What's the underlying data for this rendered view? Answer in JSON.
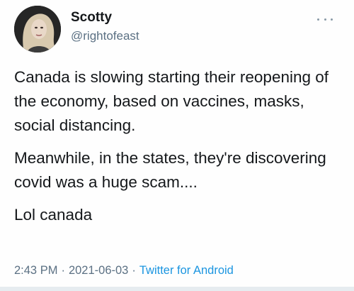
{
  "tweet": {
    "author": {
      "name": "Scotty",
      "handle": "@rightofeast"
    },
    "paragraphs": [
      "Canada is slowing starting their reopening of the economy, based on vaccines, masks, social distancing.",
      "Meanwhile, in the states, they're discovering covid was a huge scam....",
      "Lol canada"
    ],
    "time": "2:43 PM",
    "date": "2021-06-03",
    "separator": "·",
    "source": "Twitter for Android"
  },
  "icons": {
    "more": "more-options-icon",
    "avatar": "profile-photo"
  },
  "colors": {
    "text": "#14171a",
    "secondary": "#5b7083",
    "link": "#1b95e0"
  }
}
